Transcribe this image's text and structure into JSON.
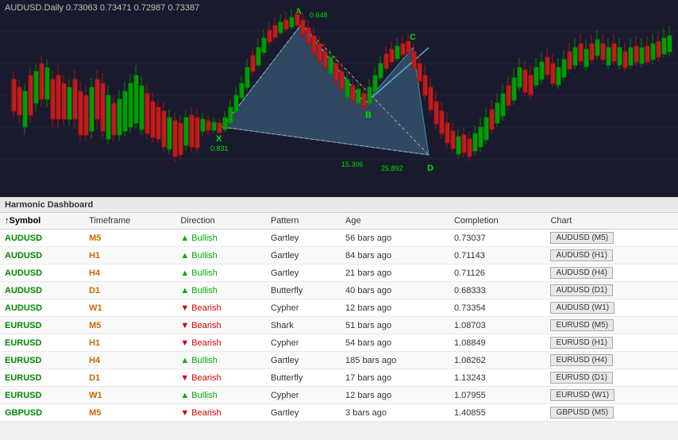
{
  "chart": {
    "title": "AUDUSD.Daily  0.73063  0.73471  0.72987  0.73387",
    "labels": {
      "A": "A",
      "B": "B",
      "C": "C",
      "X": "X",
      "val_0648": "0.648",
      "val_0831": "0.831",
      "val_15306": "15.306",
      "val_25892": "25.892"
    }
  },
  "dashboard": {
    "title": "Harmonic Dashboard",
    "columns": {
      "symbol": "↑Symbol",
      "timeframe": "Timeframe",
      "direction": "Direction",
      "pattern": "Pattern",
      "age": "Age",
      "completion": "Completion",
      "chart": "Chart"
    },
    "rows": [
      {
        "symbol": "AUDUSD",
        "tf": "M5",
        "dir": "Bullish",
        "dirType": "bull",
        "pattern": "Gartley",
        "age": "56 bars ago",
        "completion": "0.73037",
        "chartBtn": "AUDUSD (M5)"
      },
      {
        "symbol": "AUDUSD",
        "tf": "H1",
        "dir": "Bullish",
        "dirType": "bull",
        "pattern": "Gartley",
        "age": "84 bars ago",
        "completion": "0.71143",
        "chartBtn": "AUDUSD (H1)"
      },
      {
        "symbol": "AUDUSD",
        "tf": "H4",
        "dir": "Bullish",
        "dirType": "bull",
        "pattern": "Gartley",
        "age": "21 bars ago",
        "completion": "0.71126",
        "chartBtn": "AUDUSD (H4)"
      },
      {
        "symbol": "AUDUSD",
        "tf": "D1",
        "dir": "Bullish",
        "dirType": "bull",
        "pattern": "Butterfly",
        "age": "40 bars ago",
        "completion": "0.68333",
        "chartBtn": "AUDUSD (D1)"
      },
      {
        "symbol": "AUDUSD",
        "tf": "W1",
        "dir": "Bearish",
        "dirType": "bear",
        "pattern": "Cypher",
        "age": "12 bars ago",
        "completion": "0.73354",
        "chartBtn": "AUDUSD (W1)"
      },
      {
        "symbol": "EURUSD",
        "tf": "M5",
        "dir": "Bearish",
        "dirType": "bear",
        "pattern": "Shark",
        "age": "51 bars ago",
        "completion": "1.08703",
        "chartBtn": "EURUSD (M5)"
      },
      {
        "symbol": "EURUSD",
        "tf": "H1",
        "dir": "Bearish",
        "dirType": "bear",
        "pattern": "Cypher",
        "age": "54 bars ago",
        "completion": "1.08849",
        "chartBtn": "EURUSD (H1)"
      },
      {
        "symbol": "EURUSD",
        "tf": "H4",
        "dir": "Bullish",
        "dirType": "bull",
        "pattern": "Gartley",
        "age": "185 bars ago",
        "completion": "1.08262",
        "chartBtn": "EURUSD (H4)"
      },
      {
        "symbol": "EURUSD",
        "tf": "D1",
        "dir": "Bearish",
        "dirType": "bear",
        "pattern": "Butterfly",
        "age": "17 bars ago",
        "completion": "1.13243",
        "chartBtn": "EURUSD (D1)"
      },
      {
        "symbol": "EURUSD",
        "tf": "W1",
        "dir": "Bullish",
        "dirType": "bull",
        "pattern": "Cypher",
        "age": "12 bars ago",
        "completion": "1.07955",
        "chartBtn": "EURUSD (W1)"
      },
      {
        "symbol": "GBPUSD",
        "tf": "M5",
        "dir": "Bearish",
        "dirType": "bear",
        "pattern": "Gartley",
        "age": "3 bars ago",
        "completion": "1.40855",
        "chartBtn": "GBPUSD (M5)"
      }
    ]
  }
}
